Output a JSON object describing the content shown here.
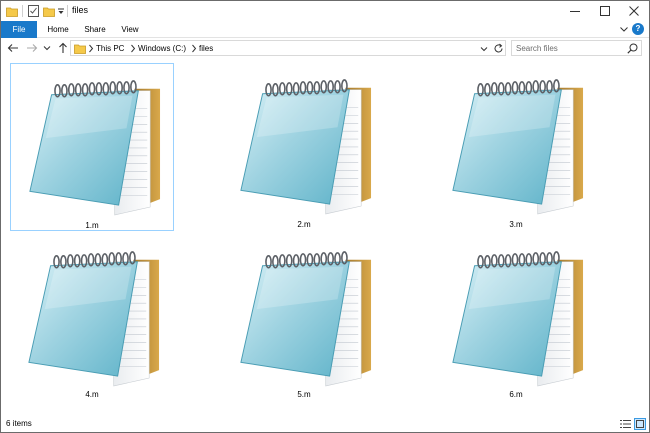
{
  "window": {
    "title": "files"
  },
  "ribbon": {
    "tabs": [
      "File",
      "Home",
      "Share",
      "View"
    ],
    "help_label": "?"
  },
  "navigation": {
    "breadcrumb": [
      "This PC",
      "Windows (C:)",
      "files"
    ],
    "search_placeholder": "Search files"
  },
  "files": [
    {
      "name": "1.m",
      "icon": "notepad-icon",
      "selected": true
    },
    {
      "name": "2.m",
      "icon": "notepad-icon",
      "selected": false
    },
    {
      "name": "3.m",
      "icon": "notepad-icon",
      "selected": false
    },
    {
      "name": "4.m",
      "icon": "notepad-icon",
      "selected": false
    },
    {
      "name": "5.m",
      "icon": "notepad-icon",
      "selected": false
    },
    {
      "name": "6.m",
      "icon": "notepad-icon",
      "selected": false
    }
  ],
  "status": {
    "item_count": "6 items"
  },
  "colors": {
    "accent": "#1979ca",
    "selection_border": "#99d1ff",
    "selection_fill": "#cce8ff"
  }
}
